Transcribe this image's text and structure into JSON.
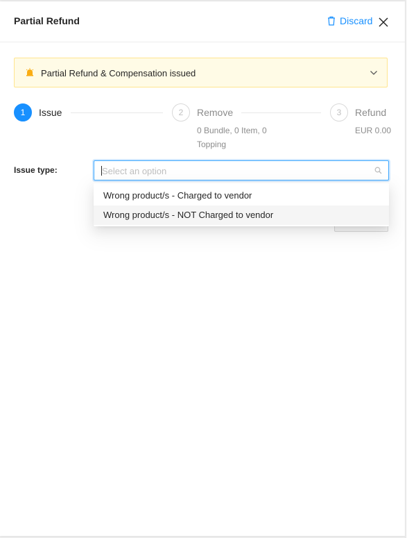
{
  "header": {
    "title": "Partial Refund",
    "discard_label": "Discard"
  },
  "banner": {
    "text": "Partial Refund & Compensation issued"
  },
  "steps": [
    {
      "number": "1",
      "title": "Issue",
      "status": "active"
    },
    {
      "number": "2",
      "title": "Remove",
      "desc_line1": "0 Bundle, 0 Item, 0",
      "desc_line2": "Topping",
      "status": "wait"
    },
    {
      "number": "3",
      "title": "Refund",
      "desc_line1": "EUR 0.00",
      "status": "wait"
    }
  ],
  "form": {
    "issue_type_label": "Issue type:",
    "select_placeholder": "Select an option"
  },
  "dropdown": {
    "options": [
      {
        "label": "Wrong product/s - Charged to vendor"
      },
      {
        "label": "Wrong product/s - NOT Charged to vendor"
      }
    ]
  },
  "colors": {
    "accent": "#1890ff",
    "banner_bg": "#fffbe6",
    "banner_border": "#ffe58f",
    "bell": "#faad14"
  }
}
